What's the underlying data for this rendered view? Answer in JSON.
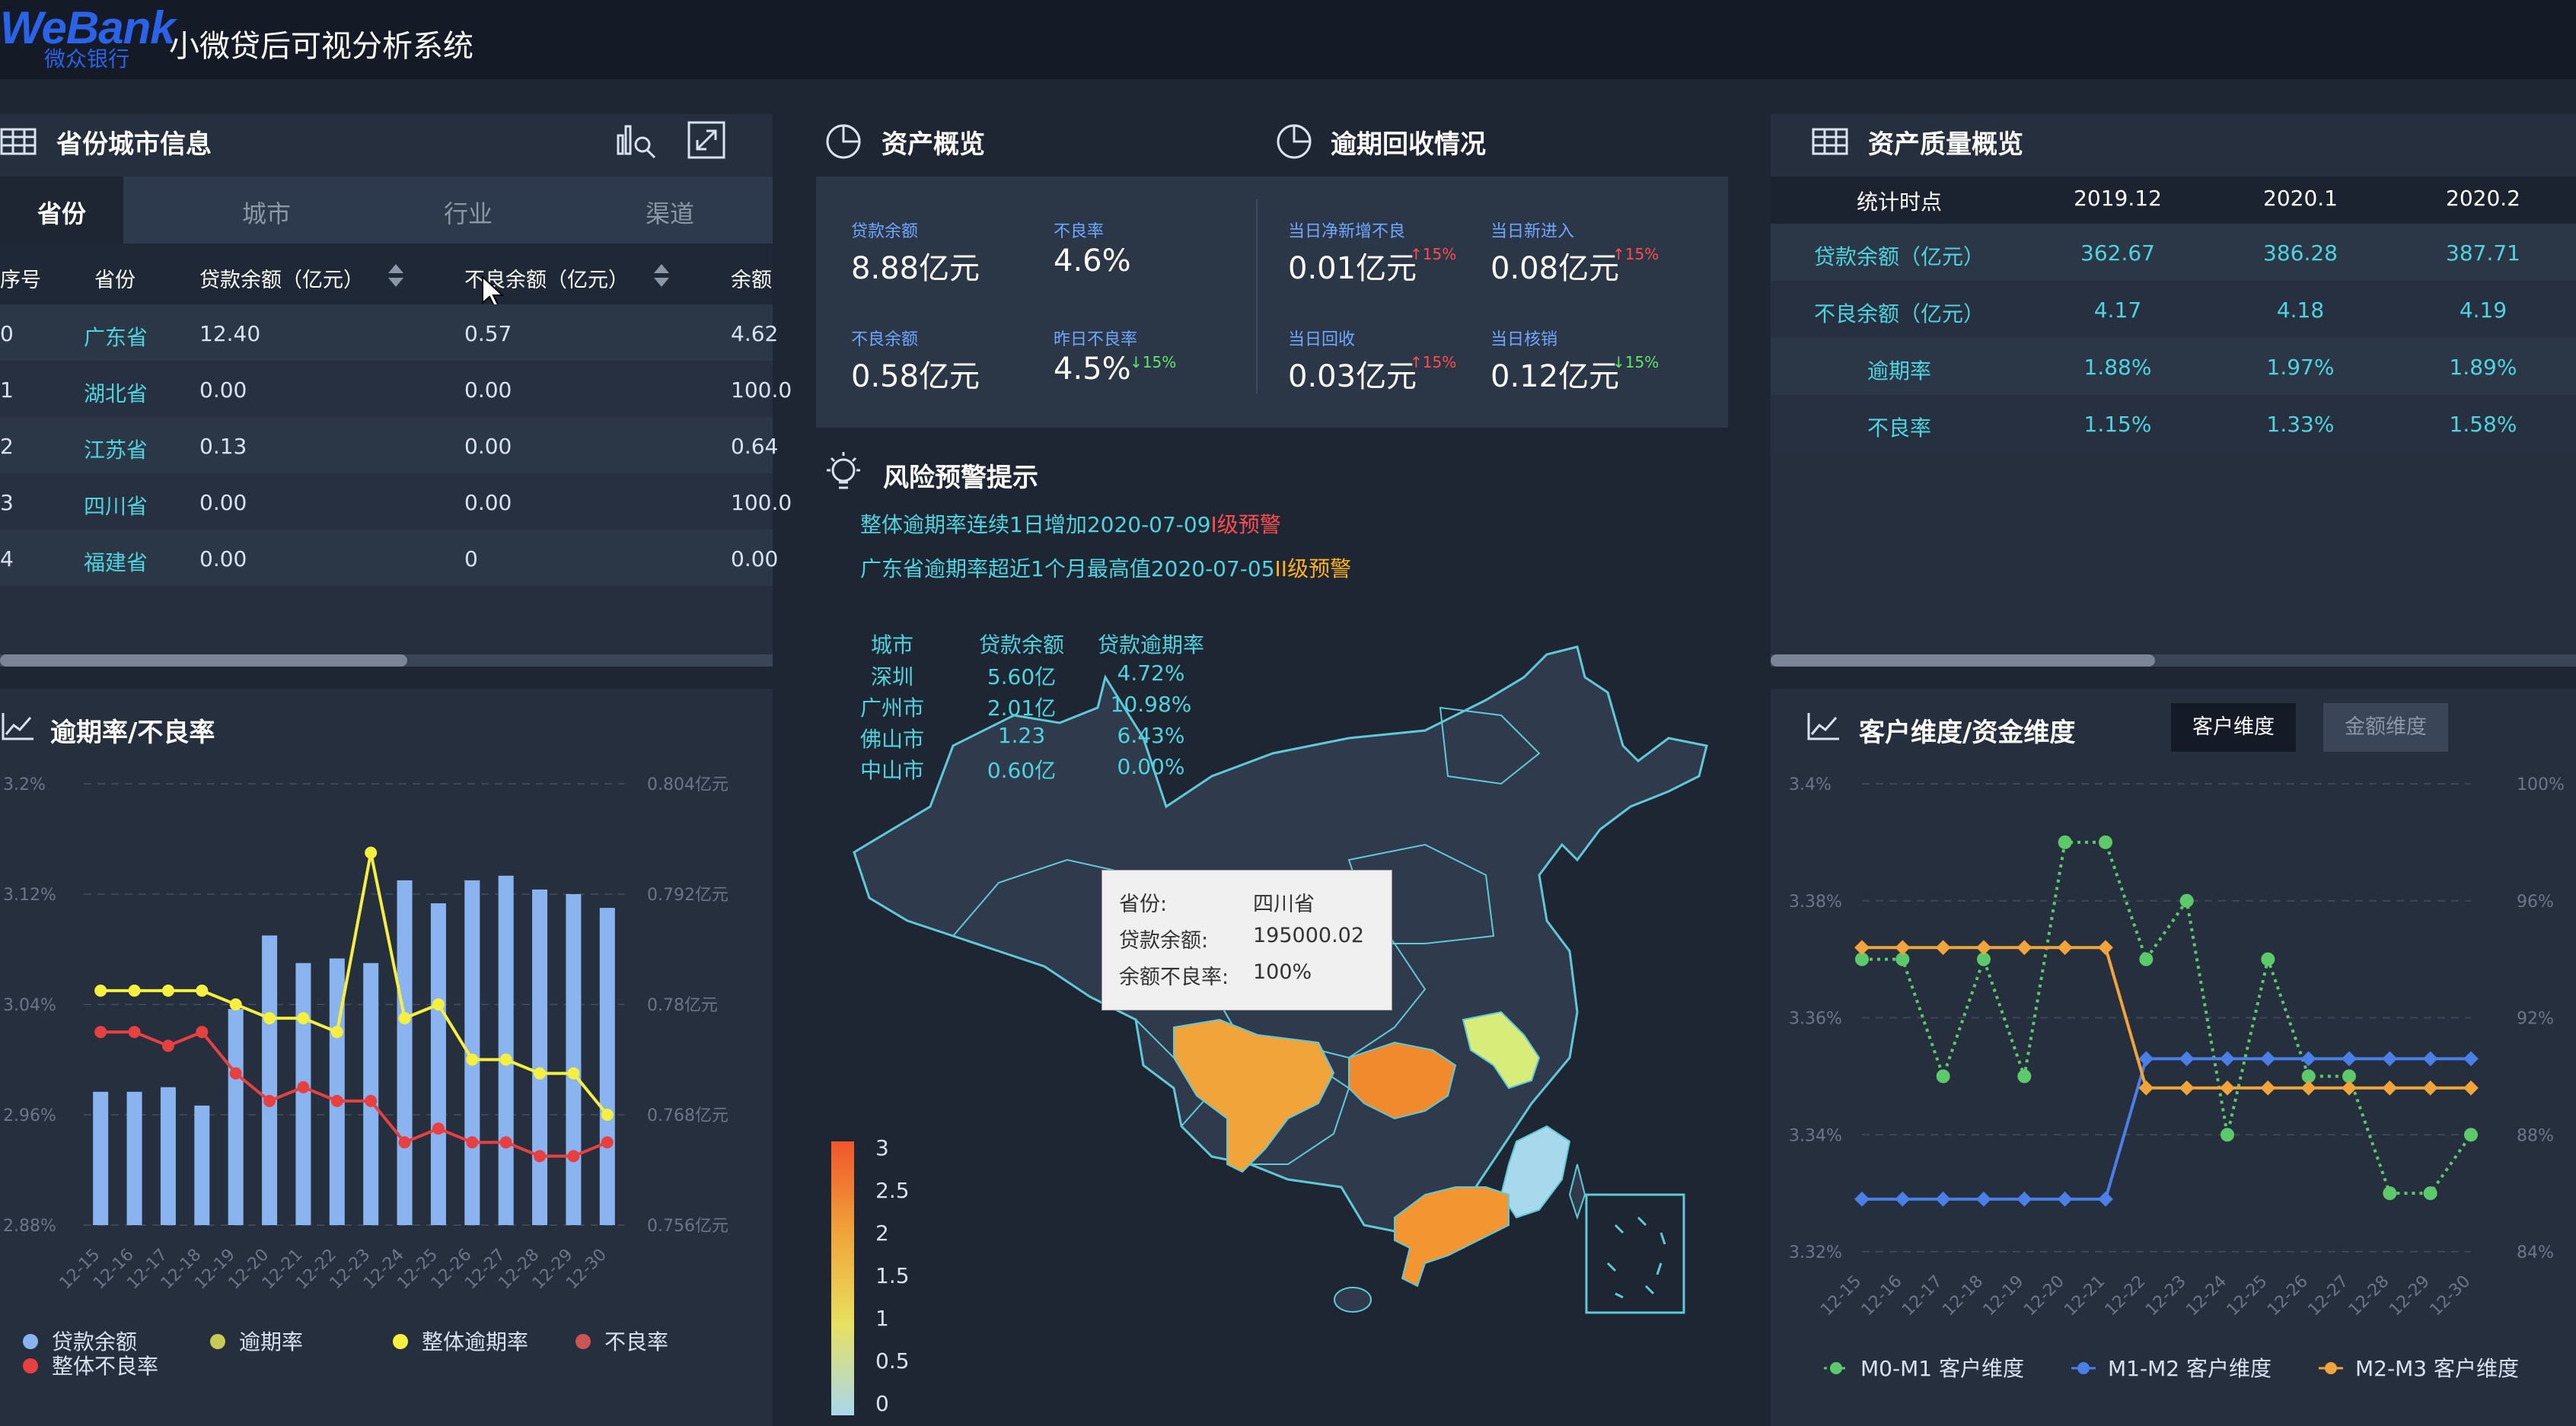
{
  "header": {
    "logo_text": "WeBank",
    "logo_sub": "微众银行",
    "title": "小微贷后可视分析系统"
  },
  "province_panel": {
    "title": "省份城市信息",
    "tabs": [
      "省份",
      "城市",
      "行业",
      "渠道"
    ],
    "columns": [
      "序号",
      "省份",
      "贷款余额（亿元）",
      "不良余额（亿元）",
      "余额"
    ],
    "rows": [
      [
        "0",
        "广东省",
        "12.40",
        "0.57",
        "4.62"
      ],
      [
        "1",
        "湖北省",
        "0.00",
        "0.00",
        "100.0"
      ],
      [
        "2",
        "江苏省",
        "0.13",
        "0.00",
        "0.64"
      ],
      [
        "3",
        "四川省",
        "0.00",
        "0.00",
        "100.0"
      ],
      [
        "4",
        "福建省",
        "0.00",
        "0",
        "0.00"
      ]
    ]
  },
  "asset_overview": {
    "title": "资产概览",
    "items": [
      {
        "label": "贷款余额",
        "value": "8.88亿元"
      },
      {
        "label": "不良率",
        "value": "4.6%"
      },
      {
        "label": "不良余额",
        "value": "0.58亿元"
      },
      {
        "label": "昨日不良率",
        "value": "4.5%",
        "trend": "↓15%"
      }
    ]
  },
  "overdue_recovery": {
    "title": "逾期回收情况",
    "items": [
      {
        "label": "当日净新增不良",
        "value": "0.01亿元",
        "trend": "↑15%"
      },
      {
        "label": "当日新进入",
        "value": "0.08亿元",
        "trend": "↑15%"
      },
      {
        "label": "当日回收",
        "value": "0.03亿元",
        "trend": "↑15%"
      },
      {
        "label": "当日核销",
        "value": "0.12亿元",
        "trend": "↓15%"
      }
    ]
  },
  "quality_panel": {
    "title": "资产质量概览",
    "columns": [
      "统计时点",
      "2019.12",
      "2020.1",
      "2020.2"
    ],
    "rows": [
      [
        "贷款余额（亿元）",
        "362.67",
        "386.28",
        "387.71"
      ],
      [
        "不良余额（亿元）",
        "4.17",
        "4.18",
        "4.19"
      ],
      [
        "逾期率",
        "1.88%",
        "1.97%",
        "1.89%"
      ],
      [
        "不良率",
        "1.15%",
        "1.33%",
        "1.58%"
      ]
    ]
  },
  "risk_panel": {
    "title": "风险预警提示",
    "alerts": [
      {
        "text": "整体逾期率连续1日增加2020-07-09",
        "level": "I级预警",
        "color": "#ff4d4d"
      },
      {
        "text": "广东省逾期率超近1个月最高值2020-07-05",
        "level": "II级预警",
        "color": "#ffb319"
      }
    ],
    "city_table": {
      "columns": [
        "城市",
        "贷款余额",
        "贷款逾期率"
      ],
      "rows": [
        [
          "深圳",
          "5.60亿",
          "4.72%"
        ],
        [
          "广州市",
          "2.01亿",
          "10.98%"
        ],
        [
          "佛山市",
          "1.23",
          "6.43%"
        ],
        [
          "中山市",
          "0.60亿",
          "0.00%"
        ]
      ]
    },
    "tooltip": {
      "rows": [
        {
          "k": "省份:",
          "v": "四川省"
        },
        {
          "k": "贷款余额:",
          "v": "195000.02"
        },
        {
          "k": "余额不良率:",
          "v": "100%"
        }
      ]
    },
    "scale": [
      "3",
      "2.5",
      "2",
      "1.5",
      "1",
      "0.5",
      "0"
    ],
    "colors": {
      "sichuan": "#f0a43a",
      "hubei": "#f08a2c",
      "guangdong": "#f39530",
      "jiangsu": "#d8ec7a",
      "fujian": "#a8d8ec",
      "base": "#2f3a4c",
      "border": "#5fc9d6"
    }
  },
  "overdue_chart_panel": {
    "title": "逾期率/不良率"
  },
  "customer_panel": {
    "title": "客户维度/资金维度",
    "btn_customer": "客户维度",
    "btn_amount": "金额维度"
  },
  "chart_data": [
    {
      "type": "bar",
      "title": "逾期率/不良率",
      "categories": [
        "12-15",
        "12-16",
        "12-17",
        "12-18",
        "12-19",
        "12-20",
        "12-21",
        "12-22",
        "12-23",
        "12-24",
        "12-25",
        "12-26",
        "12-27",
        "12-28",
        "12-29",
        "12-30"
      ],
      "y_left": {
        "ticks": [
          "2.88%",
          "2.96%",
          "3.04%",
          "3.12%",
          "3.2%"
        ],
        "range": [
          2.88,
          3.2
        ]
      },
      "y_right": {
        "ticks": [
          "0.756亿元",
          "0.768亿元",
          "0.78亿元",
          "0.792亿元",
          "0.804亿元"
        ],
        "range": [
          0.756,
          0.804
        ]
      },
      "series": [
        {
          "name": "贷款余额",
          "kind": "bar",
          "axis": "right",
          "color": "#8ab4f0",
          "values": [
            0.7705,
            0.7705,
            0.771,
            0.769,
            0.7795,
            0.7875,
            0.7845,
            0.785,
            0.7845,
            0.7935,
            0.791,
            0.7935,
            0.794,
            0.7925,
            0.792,
            0.7905
          ]
        },
        {
          "name": "整体逾期率",
          "kind": "line",
          "axis": "left",
          "color": "#f5f040",
          "values": [
            3.05,
            3.05,
            3.05,
            3.05,
            3.04,
            3.03,
            3.03,
            3.02,
            3.15,
            3.03,
            3.04,
            3.0,
            3.0,
            2.99,
            2.99,
            2.96
          ]
        },
        {
          "name": "不良率",
          "kind": "line",
          "axis": "left",
          "color": "#e84040",
          "values": [
            3.02,
            3.02,
            3.01,
            3.02,
            2.99,
            2.97,
            2.98,
            2.97,
            2.97,
            2.94,
            2.95,
            2.94,
            2.94,
            2.93,
            2.93,
            2.94
          ]
        }
      ],
      "legend": [
        "贷款余额",
        "逾期率",
        "整体逾期率",
        "不良率",
        "整体不良率"
      ],
      "legend_colors": [
        "#8ab4f0",
        "#c9c955",
        "#f5f040",
        "#c95555",
        "#e84040"
      ]
    },
    {
      "type": "line",
      "title": "客户维度/资金维度",
      "categories": [
        "12-15",
        "12-16",
        "12-17",
        "12-18",
        "12-19",
        "12-20",
        "12-21",
        "12-22",
        "12-23",
        "12-24",
        "12-25",
        "12-26",
        "12-27",
        "12-28",
        "12-29",
        "12-30"
      ],
      "y_left": {
        "ticks": [
          "3.32%",
          "3.34%",
          "3.36%",
          "3.38%",
          "3.4%"
        ],
        "range": [
          3.32,
          3.4
        ]
      },
      "y_right": {
        "ticks": [
          "84%",
          "88%",
          "92%",
          "96%",
          "100%"
        ],
        "range": [
          84,
          100
        ]
      },
      "series": [
        {
          "name": "M0-M1 客户维度",
          "color": "#5cc96a",
          "dashed": true,
          "values": [
            3.37,
            3.37,
            3.35,
            3.37,
            3.35,
            3.39,
            3.39,
            3.37,
            3.38,
            3.34,
            3.37,
            3.35,
            3.35,
            3.33,
            3.33,
            3.34
          ]
        },
        {
          "name": "M1-M2 客户维度",
          "color": "#4a7fe8",
          "values": [
            3.329,
            3.329,
            3.329,
            3.329,
            3.329,
            3.329,
            3.329,
            3.353,
            3.353,
            3.353,
            3.353,
            3.353,
            3.353,
            3.353,
            3.353,
            3.353
          ]
        },
        {
          "name": "M2-M3 客户维度",
          "color": "#f0a43a",
          "values": [
            3.372,
            3.372,
            3.372,
            3.372,
            3.372,
            3.372,
            3.372,
            3.348,
            3.348,
            3.348,
            3.348,
            3.348,
            3.348,
            3.348,
            3.348,
            3.348
          ]
        }
      ]
    }
  ]
}
